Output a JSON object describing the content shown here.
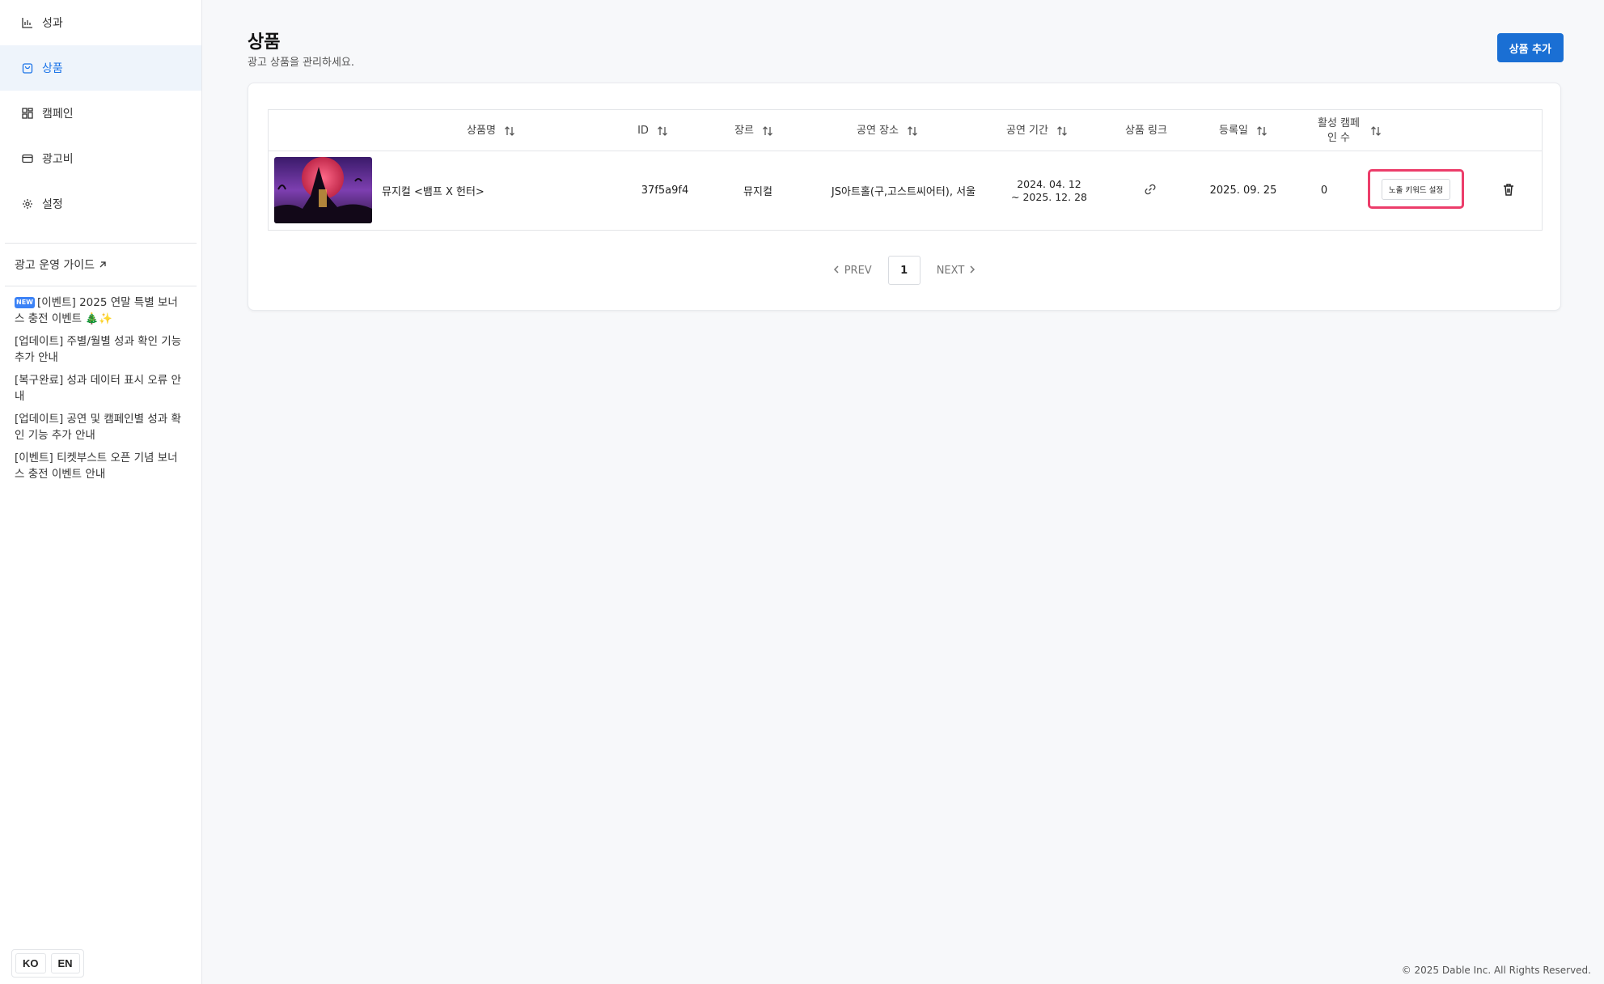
{
  "sidebar": {
    "nav": [
      {
        "label": "성과",
        "icon": "bar-chart-icon"
      },
      {
        "label": "상품",
        "icon": "shopping-bag-icon",
        "active": true
      },
      {
        "label": "캠페인",
        "icon": "grid-icon"
      },
      {
        "label": "광고비",
        "icon": "credit-card-icon"
      },
      {
        "label": "설정",
        "icon": "gear-icon"
      }
    ],
    "guide_link": "광고 운영 가이드",
    "notices": [
      {
        "badge": "NEW",
        "text": "[이벤트] 2025 연말 특별 보너스 충전 이벤트 🎄✨"
      },
      {
        "text": "[업데이트] 주별/월별 성과 확인 기능 추가 안내"
      },
      {
        "text": "[복구완료] 성과 데이터 표시 오류 안내"
      },
      {
        "text": "[업데이트] 공연 및 캠페인별 성과 확인 기능 추가 안내"
      },
      {
        "text": "[이벤트] 티켓부스트 오픈 기념 보너스 충전 이벤트 안내"
      }
    ],
    "lang": {
      "ko": "KO",
      "en": "EN"
    }
  },
  "header": {
    "title": "상품",
    "subtitle": "광고 상품을 관리하세요.",
    "add_button": "상품 추가"
  },
  "table": {
    "columns": {
      "name": "상품명",
      "id": "ID",
      "genre": "장르",
      "venue": "공연 장소",
      "period": "공연 기간",
      "link": "상품 링크",
      "registered": "등록일",
      "active_campaigns": "활성 캠페인 수"
    },
    "rows": [
      {
        "name": "뮤지컬 <뱀프 X 헌터>",
        "id": "37f5a9f4",
        "genre": "뮤지컬",
        "venue": "JS아트홀(구,고스트씨어터), 서울",
        "period_start": "2024. 04. 12",
        "period_end": "~ 2025. 12. 28",
        "registered": "2025. 09. 25",
        "active_campaigns": "0",
        "keyword_button": "노출 키워드 설정"
      }
    ]
  },
  "pagination": {
    "prev": "PREV",
    "next": "NEXT",
    "current": "1"
  },
  "footer": "© 2025 Dable Inc. All Rights Reserved.",
  "colors": {
    "accent": "#1a6fd4",
    "highlight": "#ec3d6a",
    "active_bg": "#eef4fb"
  }
}
